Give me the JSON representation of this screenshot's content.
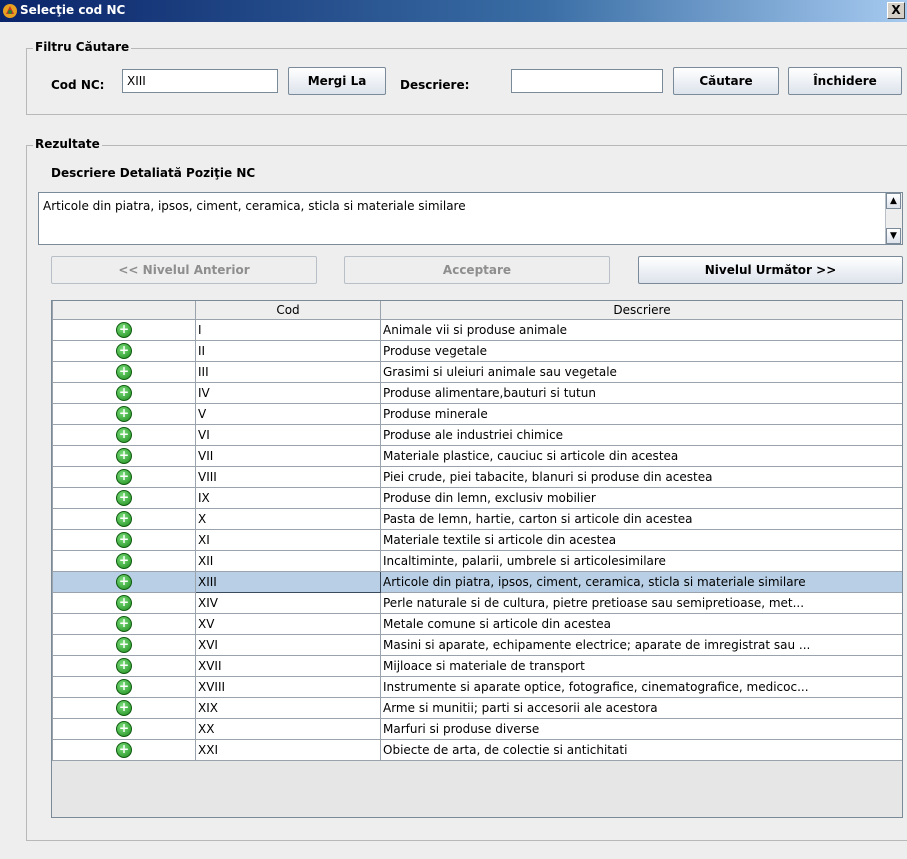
{
  "window": {
    "title": "Selecţie cod NC",
    "close_glyph": "X"
  },
  "filter": {
    "group_title": "Filtru Căutare",
    "cod_label": "Cod NC:",
    "cod_value": "XIII",
    "go_button": "Mergi La",
    "desc_label": "Descriere:",
    "desc_value": "",
    "search_button": "Căutare",
    "close_button": "Închidere"
  },
  "results": {
    "group_title": "Rezultate",
    "detail_heading": "Descriere Detaliată Poziţie NC",
    "detail_text": "Articole din piatra, ipsos, ciment, ceramica, sticla si materiale similare",
    "prev_button": "<< Nivelul Anterior",
    "accept_button": "Acceptare",
    "next_button": "Nivelul Următor >>"
  },
  "table": {
    "columns": [
      "",
      "Cod",
      "Descriere"
    ],
    "selected_index": 12,
    "rows": [
      {
        "code": "I",
        "desc": "Animale vii si produse animale"
      },
      {
        "code": "II",
        "desc": "Produse vegetale"
      },
      {
        "code": "III",
        "desc": "Grasimi si uleiuri animale sau vegetale"
      },
      {
        "code": "IV",
        "desc": "Produse alimentare,bauturi si tutun"
      },
      {
        "code": "V",
        "desc": "Produse minerale"
      },
      {
        "code": "VI",
        "desc": "Produse ale industriei chimice"
      },
      {
        "code": "VII",
        "desc": "Materiale plastice, cauciuc si articole din acestea"
      },
      {
        "code": "VIII",
        "desc": "Piei crude, piei tabacite, blanuri si produse din acestea"
      },
      {
        "code": "IX",
        "desc": "Produse din lemn, exclusiv mobilier"
      },
      {
        "code": "X",
        "desc": "Pasta de lemn, hartie, carton si articole din acestea"
      },
      {
        "code": "XI",
        "desc": "Materiale textile si articole din acestea"
      },
      {
        "code": "XII",
        "desc": "Incaltiminte, palarii, umbrele si articolesimilare"
      },
      {
        "code": "XIII",
        "desc": "Articole din piatra, ipsos, ciment, ceramica, sticla si materiale similare"
      },
      {
        "code": "XIV",
        "desc": "Perle naturale si de cultura, pietre pretioase sau semipretioase, met..."
      },
      {
        "code": "XV",
        "desc": "Metale comune si articole din acestea"
      },
      {
        "code": "XVI",
        "desc": "Masini si aparate, echipamente electrice; aparate de imregistrat sau ..."
      },
      {
        "code": "XVII",
        "desc": "Mijloace si materiale de transport"
      },
      {
        "code": "XVIII",
        "desc": "Instrumente si aparate optice, fotografice, cinematografice, medicoc..."
      },
      {
        "code": "XIX",
        "desc": "Arme si munitii; parti si accesorii ale acestora"
      },
      {
        "code": "XX",
        "desc": "Marfuri si produse diverse"
      },
      {
        "code": "XXI",
        "desc": "Obiecte de arta, de colectie si antichitati"
      }
    ]
  },
  "colors": {
    "selection": "#b8cfe5",
    "title_bar": "#0a246a",
    "expand_icon": "#1c8a1c"
  }
}
